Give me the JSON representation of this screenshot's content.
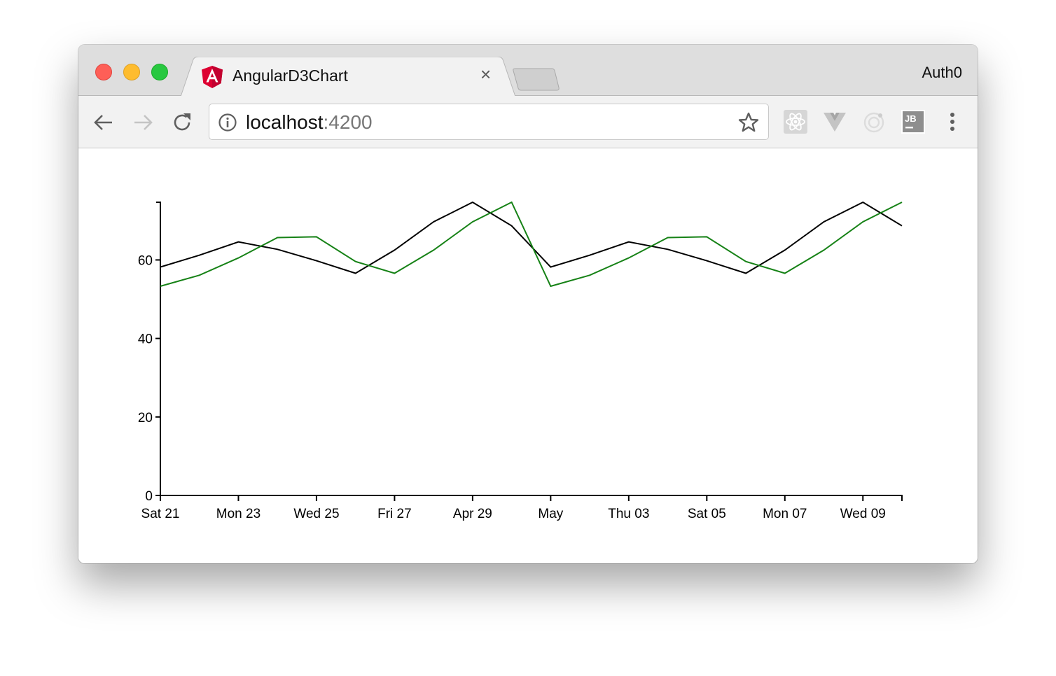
{
  "browser": {
    "tab_title": "AngularD3Chart",
    "tab_icon": "angular-logo-icon",
    "tab_close": "×",
    "profile_name": "Auth0",
    "url_host": "localhost",
    "url_port": ":4200",
    "extensions": [
      "react-devtools-icon",
      "vue-devtools-icon",
      "ionic-icon",
      "jetbrains-icon"
    ]
  },
  "chart_data": {
    "type": "line",
    "title": "",
    "xlabel": "",
    "ylabel": "",
    "ylim": [
      0,
      74.7
    ],
    "yticks": [
      0,
      20,
      40,
      60
    ],
    "x": [
      "Apr 21",
      "Apr 22",
      "Apr 23",
      "Apr 24",
      "Apr 25",
      "Apr 26",
      "Apr 27",
      "Apr 28",
      "Apr 29",
      "Apr 30",
      "May 01",
      "May 02",
      "May 03",
      "May 04",
      "May 05",
      "May 06",
      "May 07",
      "May 08",
      "May 09",
      "May 10"
    ],
    "xticks": [
      {
        "index": 0,
        "label": "Sat 21"
      },
      {
        "index": 2,
        "label": "Mon 23"
      },
      {
        "index": 4,
        "label": "Wed 25"
      },
      {
        "index": 6,
        "label": "Fri 27"
      },
      {
        "index": 8,
        "label": "Apr 29"
      },
      {
        "index": 10,
        "label": "May"
      },
      {
        "index": 12,
        "label": "Thu 03"
      },
      {
        "index": 14,
        "label": "Sat 05"
      },
      {
        "index": 16,
        "label": "Mon 07"
      },
      {
        "index": 18,
        "label": "Wed 09"
      },
      {
        "index": 19,
        "label": ""
      }
    ],
    "series": [
      {
        "name": "series-black",
        "color": "#000000",
        "values": [
          58.2,
          61.2,
          64.6,
          62.7,
          59.8,
          56.6,
          62.5,
          69.7,
          74.7,
          68.7,
          58.2,
          61.2,
          64.6,
          62.7,
          59.8,
          56.6,
          62.5,
          69.7,
          74.7,
          68.7
        ]
      },
      {
        "name": "series-green",
        "color": "#168216",
        "values": [
          53.3,
          56.1,
          60.5,
          65.7,
          65.9,
          59.6,
          56.6,
          62.5,
          69.7,
          74.7,
          53.3,
          56.1,
          60.5,
          65.7,
          65.9,
          59.6,
          56.6,
          62.5,
          69.7,
          74.7
        ]
      }
    ],
    "grid": false,
    "legend": "none"
  }
}
